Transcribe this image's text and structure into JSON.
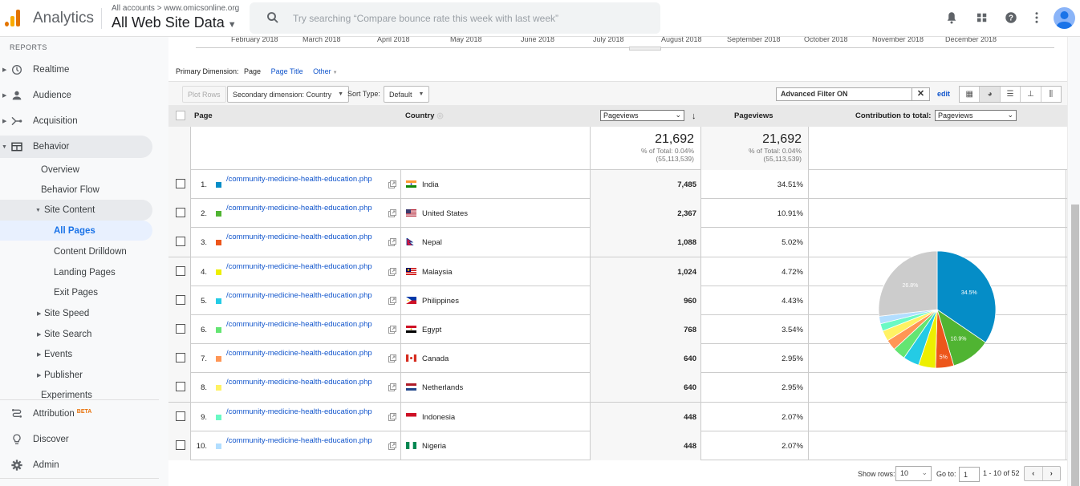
{
  "topbar": {
    "app_name": "Analytics",
    "breadcrumb": "All accounts > www.omicsonline.org",
    "property": "All Web Site Data",
    "search_placeholder": "Try searching “Compare bounce rate this week with last week”",
    "icons": [
      "bell-icon",
      "apps-grid-icon",
      "help-icon",
      "more-vert-icon",
      "account-avatar"
    ]
  },
  "sidebar": {
    "section_label": "REPORTS",
    "items": [
      {
        "label": "Realtime",
        "icon": "clock-icon"
      },
      {
        "label": "Audience",
        "icon": "person-icon"
      },
      {
        "label": "Acquisition",
        "icon": "acquisition-icon"
      },
      {
        "label": "Behavior",
        "icon": "behavior-icon"
      },
      {
        "label": "Overview"
      },
      {
        "label": "Behavior Flow"
      },
      {
        "label": "Site Content"
      },
      {
        "label": "All Pages"
      },
      {
        "label": "Content Drilldown"
      },
      {
        "label": "Landing Pages"
      },
      {
        "label": "Exit Pages"
      },
      {
        "label": "Site Speed"
      },
      {
        "label": "Site Search"
      },
      {
        "label": "Events"
      },
      {
        "label": "Publisher"
      },
      {
        "label": "Experiments"
      }
    ],
    "bottom": [
      {
        "label": "Attribution",
        "badge": "BETA",
        "icon": "attribution-icon"
      },
      {
        "label": "Discover",
        "icon": "lightbulb-icon"
      },
      {
        "label": "Admin",
        "icon": "gear-icon"
      }
    ]
  },
  "timeline": {
    "months": [
      "February 2018",
      "March 2018",
      "April 2018",
      "May 2018",
      "June 2018",
      "July 2018",
      "August 2018",
      "September 2018",
      "October 2018",
      "November 2018",
      "December 2018"
    ]
  },
  "primary_dimension": {
    "label": "Primary Dimension:",
    "current": "Page",
    "options": [
      "Page Title",
      "Other"
    ]
  },
  "toolbar": {
    "plot_rows": "Plot Rows",
    "secondary_dimension": "Secondary dimension: Country",
    "sort_type_label": "Sort Type:",
    "sort_type_value": "Default",
    "filter_value": "Advanced Filter ON",
    "edit_label": "edit"
  },
  "table": {
    "headers": {
      "page": "Page",
      "country": "Country",
      "metric_select": "Pageviews",
      "pageviews": "Pageviews",
      "contribution_label": "Contribution to total:",
      "contribution_select": "Pageviews"
    },
    "totals": {
      "value": "21,692",
      "pct_of_total": "% of Total: 0.04%",
      "grand_total": "(55,113,539)"
    },
    "rows": [
      {
        "n": "1.",
        "color": "#058dc7",
        "page": "/community-medicine-health-education.php",
        "country": "India",
        "flag": "india",
        "pageviews": "7,485",
        "pct": "34.51%"
      },
      {
        "n": "2.",
        "color": "#50b432",
        "page": "/community-medicine-health-education.php",
        "country": "United States",
        "flag": "us",
        "pageviews": "2,367",
        "pct": "10.91%"
      },
      {
        "n": "3.",
        "color": "#ed561b",
        "page": "/community-medicine-health-education.php",
        "country": "Nepal",
        "flag": "nepal",
        "pageviews": "1,088",
        "pct": "5.02%"
      },
      {
        "n": "4.",
        "color": "#edef00",
        "page": "/community-medicine-health-education.php",
        "country": "Malaysia",
        "flag": "malaysia",
        "pageviews": "1,024",
        "pct": "4.72%"
      },
      {
        "n": "5.",
        "color": "#24cbe5",
        "page": "/community-medicine-health-education.php",
        "country": "Philippines",
        "flag": "philippines",
        "pageviews": "960",
        "pct": "4.43%"
      },
      {
        "n": "6.",
        "color": "#64e572",
        "page": "/community-medicine-health-education.php",
        "country": "Egypt",
        "flag": "egypt",
        "pageviews": "768",
        "pct": "3.54%"
      },
      {
        "n": "7.",
        "color": "#ff9655",
        "page": "/community-medicine-health-education.php",
        "country": "Canada",
        "flag": "canada",
        "pageviews": "640",
        "pct": "2.95%"
      },
      {
        "n": "8.",
        "color": "#fff263",
        "page": "/community-medicine-health-education.php",
        "country": "Netherlands",
        "flag": "netherlands",
        "pageviews": "640",
        "pct": "2.95%"
      },
      {
        "n": "9.",
        "color": "#6af9c4",
        "page": "/community-medicine-health-education.php",
        "country": "Indonesia",
        "flag": "indonesia",
        "pageviews": "448",
        "pct": "2.07%"
      },
      {
        "n": "10.",
        "color": "#b2deff",
        "page": "/community-medicine-health-education.php",
        "country": "Nigeria",
        "flag": "nigeria",
        "pageviews": "448",
        "pct": "2.07%"
      }
    ]
  },
  "pie": {
    "other_color": "#cccccc",
    "other_pct": 26.8,
    "labels": [
      "34.5%",
      "10.9%",
      "5%",
      "26.8%"
    ]
  },
  "pagination": {
    "show_rows_label": "Show rows:",
    "show_rows_value": "10",
    "goto_label": "Go to:",
    "goto_value": "1",
    "range": "1 - 10 of 52"
  }
}
